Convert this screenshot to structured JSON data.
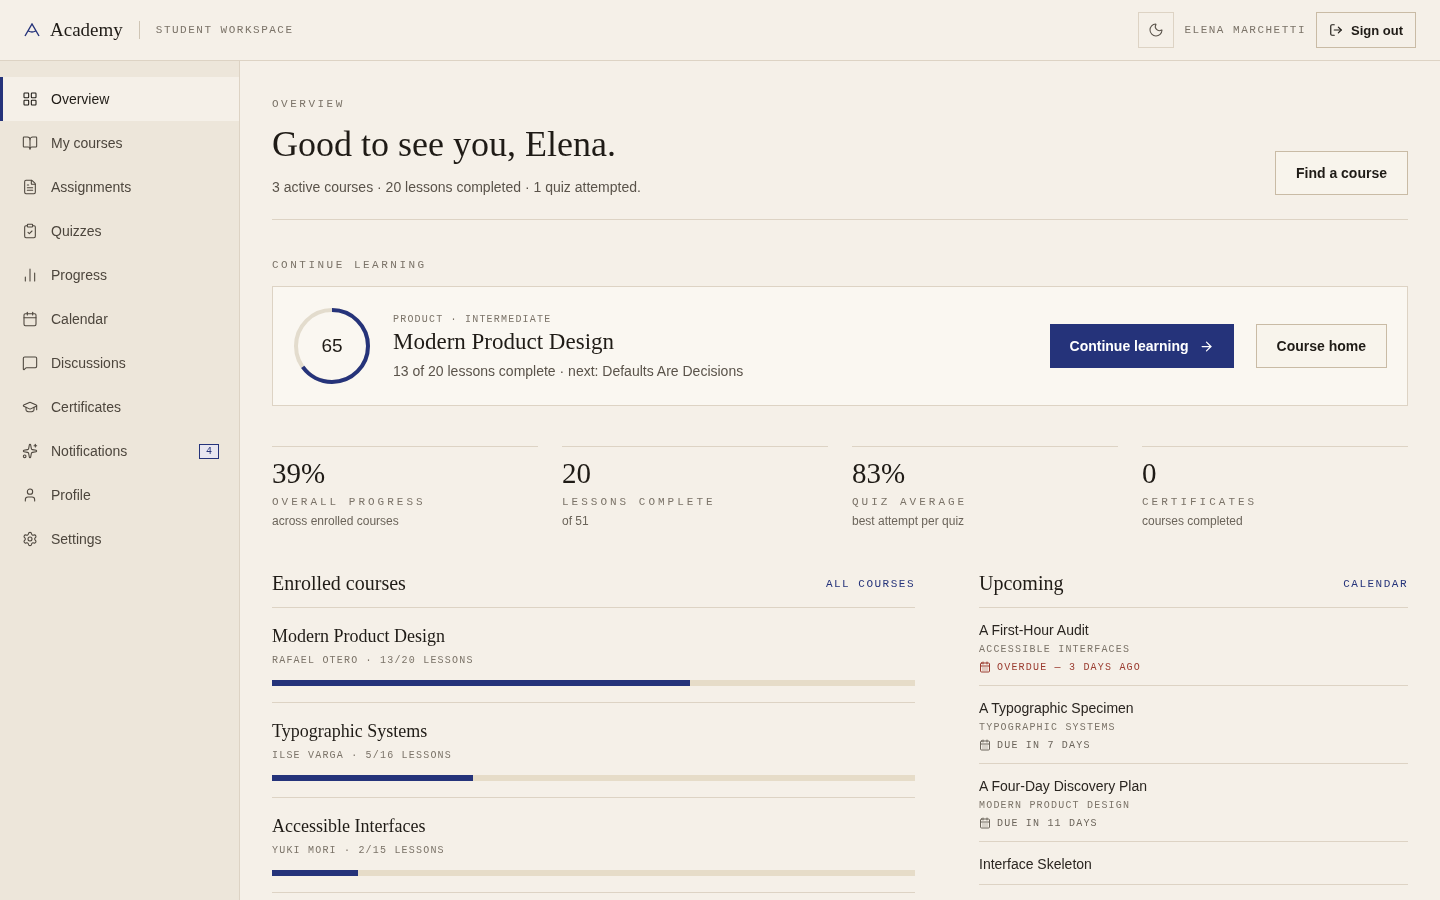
{
  "header": {
    "brand": "Academy",
    "workspace": "STUDENT WORKSPACE",
    "user": "ELENA MARCHETTI",
    "sign_out": "Sign out"
  },
  "sidebar": {
    "items": [
      {
        "label": "Overview",
        "selected": true
      },
      {
        "label": "My courses",
        "selected": false
      },
      {
        "label": "Assignments",
        "selected": false
      },
      {
        "label": "Quizzes",
        "selected": false
      },
      {
        "label": "Progress",
        "selected": false
      },
      {
        "label": "Calendar",
        "selected": false
      },
      {
        "label": "Discussions",
        "selected": false
      },
      {
        "label": "Certificates",
        "selected": false
      },
      {
        "label": "Notifications",
        "selected": false,
        "badge": "4"
      },
      {
        "label": "Profile",
        "selected": false
      },
      {
        "label": "Settings",
        "selected": false
      }
    ]
  },
  "overview": {
    "eyebrow": "OVERVIEW",
    "title": "Good to see you, Elena.",
    "summary": "3 active courses · 20 lessons completed · 1 quiz attempted.",
    "find_button": "Find a course"
  },
  "continue": {
    "heading": "CONTINUE LEARNING",
    "ring_label": "65",
    "level": 0.65,
    "meta": "PRODUCT · INTERMEDIATE",
    "title": "Modern Product Design",
    "detail": "13 of 20 lessons complete · next: Defaults Are Decisions",
    "primary": "Continue learning",
    "secondary": "Course home"
  },
  "stats": [
    {
      "value": "39%",
      "label": "OVERALL PROGRESS",
      "note": "across enrolled courses"
    },
    {
      "value": "20",
      "label": "LESSONS COMPLETE",
      "note": "of 51"
    },
    {
      "value": "83%",
      "label": "QUIZ AVERAGE",
      "note": "best attempt per quiz"
    },
    {
      "value": "0",
      "label": "CERTIFICATES",
      "note": "courses completed"
    }
  ],
  "enrolled": {
    "title": "Enrolled courses",
    "link": "ALL COURSES",
    "courses": [
      {
        "title": "Modern Product Design",
        "meta": "RAFAEL OTERO · 13/20 LESSONS",
        "level": 0.65
      },
      {
        "title": "Typographic Systems",
        "meta": "ILSE VARGA · 5/16 LESSONS",
        "level": 0.3125
      },
      {
        "title": "Accessible Interfaces",
        "meta": "YUKI MORI · 2/15 LESSONS",
        "level": 0.1333
      }
    ]
  },
  "upcoming": {
    "title": "Upcoming",
    "link": "CALENDAR",
    "items": [
      {
        "title": "A First-Hour Audit",
        "course": "ACCESSIBLE INTERFACES",
        "due": "OVERDUE — 3 DAYS AGO",
        "overdue": true
      },
      {
        "title": "A Typographic Specimen",
        "course": "TYPOGRAPHIC SYSTEMS",
        "due": "DUE IN 7 DAYS",
        "overdue": false
      },
      {
        "title": "A Four-Day Discovery Plan",
        "course": "MODERN PRODUCT DESIGN",
        "due": "DUE IN 11 DAYS",
        "overdue": false
      },
      {
        "title": "Interface Skeleton"
      }
    ]
  }
}
